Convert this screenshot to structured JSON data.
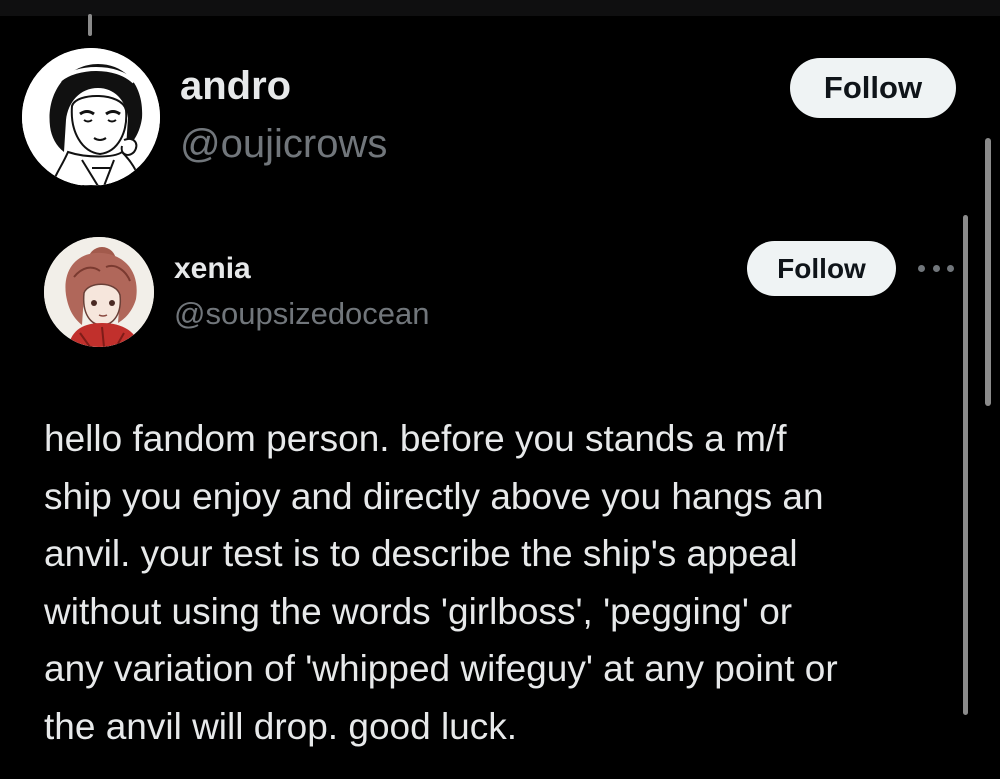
{
  "outer_post": {
    "author": {
      "display_name": "andro",
      "handle": "@oujicrows",
      "avatar_icon": "manga-character-avatar"
    },
    "follow_label": "Follow"
  },
  "quoted_post": {
    "author": {
      "display_name": "xenia",
      "handle": "@soupsizedocean",
      "avatar_icon": "illustrated-character-avatar"
    },
    "follow_label": "Follow",
    "more_icon": "more-horizontal-icon",
    "text_lines": [
      "hello fandom person. before you stands a m/f",
      "ship you enjoy and directly above you hangs an",
      "anvil. your test is to describe the ship's appeal",
      "without using the words 'girlboss', 'pegging' or",
      "any variation of 'whipped wifeguy' at any point or",
      "the anvil will drop. good luck."
    ]
  },
  "colors": {
    "background": "#000000",
    "primary_text": "#e7e9ea",
    "secondary_text": "#71767b",
    "follow_button_bg": "#eff3f4",
    "follow_button_text": "#0f1419"
  }
}
